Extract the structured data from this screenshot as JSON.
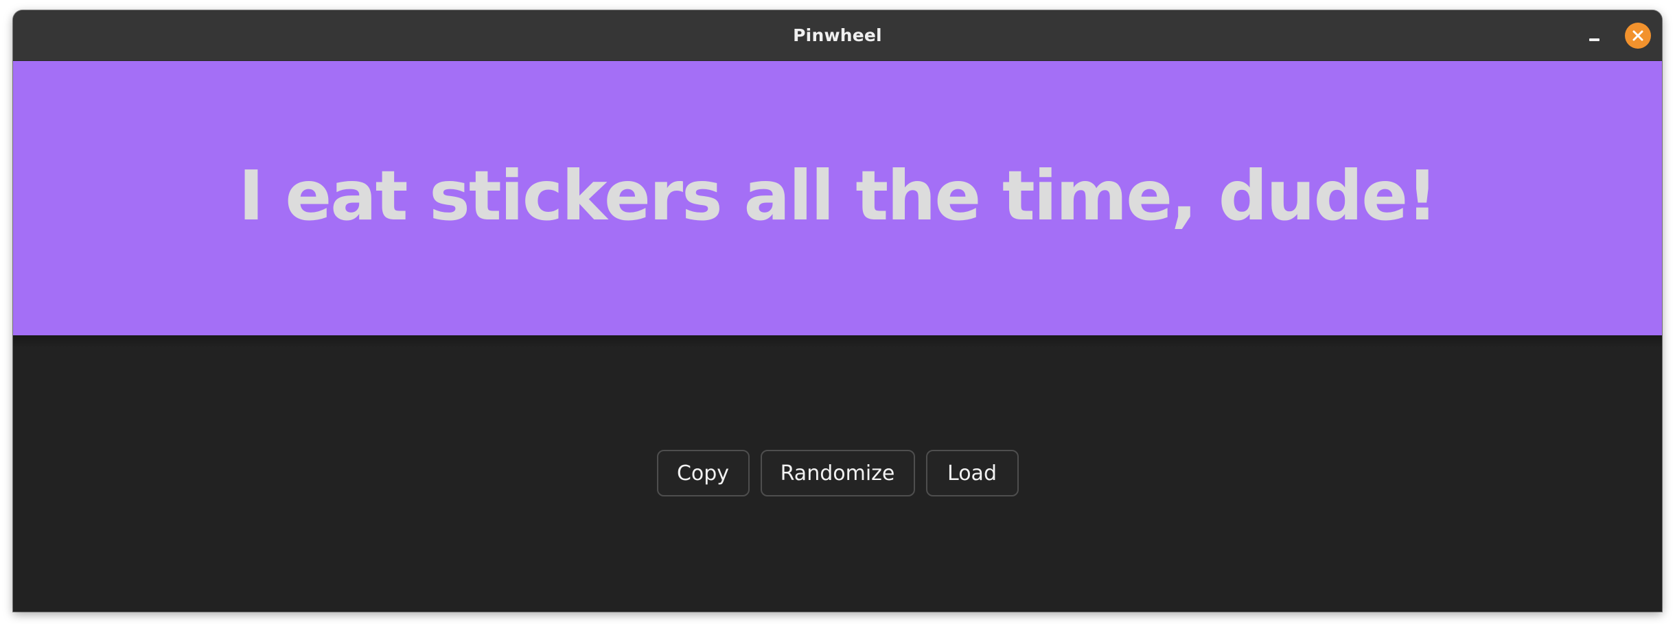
{
  "window": {
    "title": "Pinwheel"
  },
  "controls": {
    "minimize_icon": "minimize-icon",
    "close_icon": "close-icon"
  },
  "banner": {
    "text": "I eat stickers all the time, dude!",
    "background_color": "#a46ff6",
    "text_color": "#dcdcdc"
  },
  "actions": {
    "copy_label": "Copy",
    "randomize_label": "Randomize",
    "load_label": "Load"
  },
  "theme": {
    "titlebar_color": "#363636",
    "content_background": "#222222",
    "close_button_color": "#f2922d"
  }
}
